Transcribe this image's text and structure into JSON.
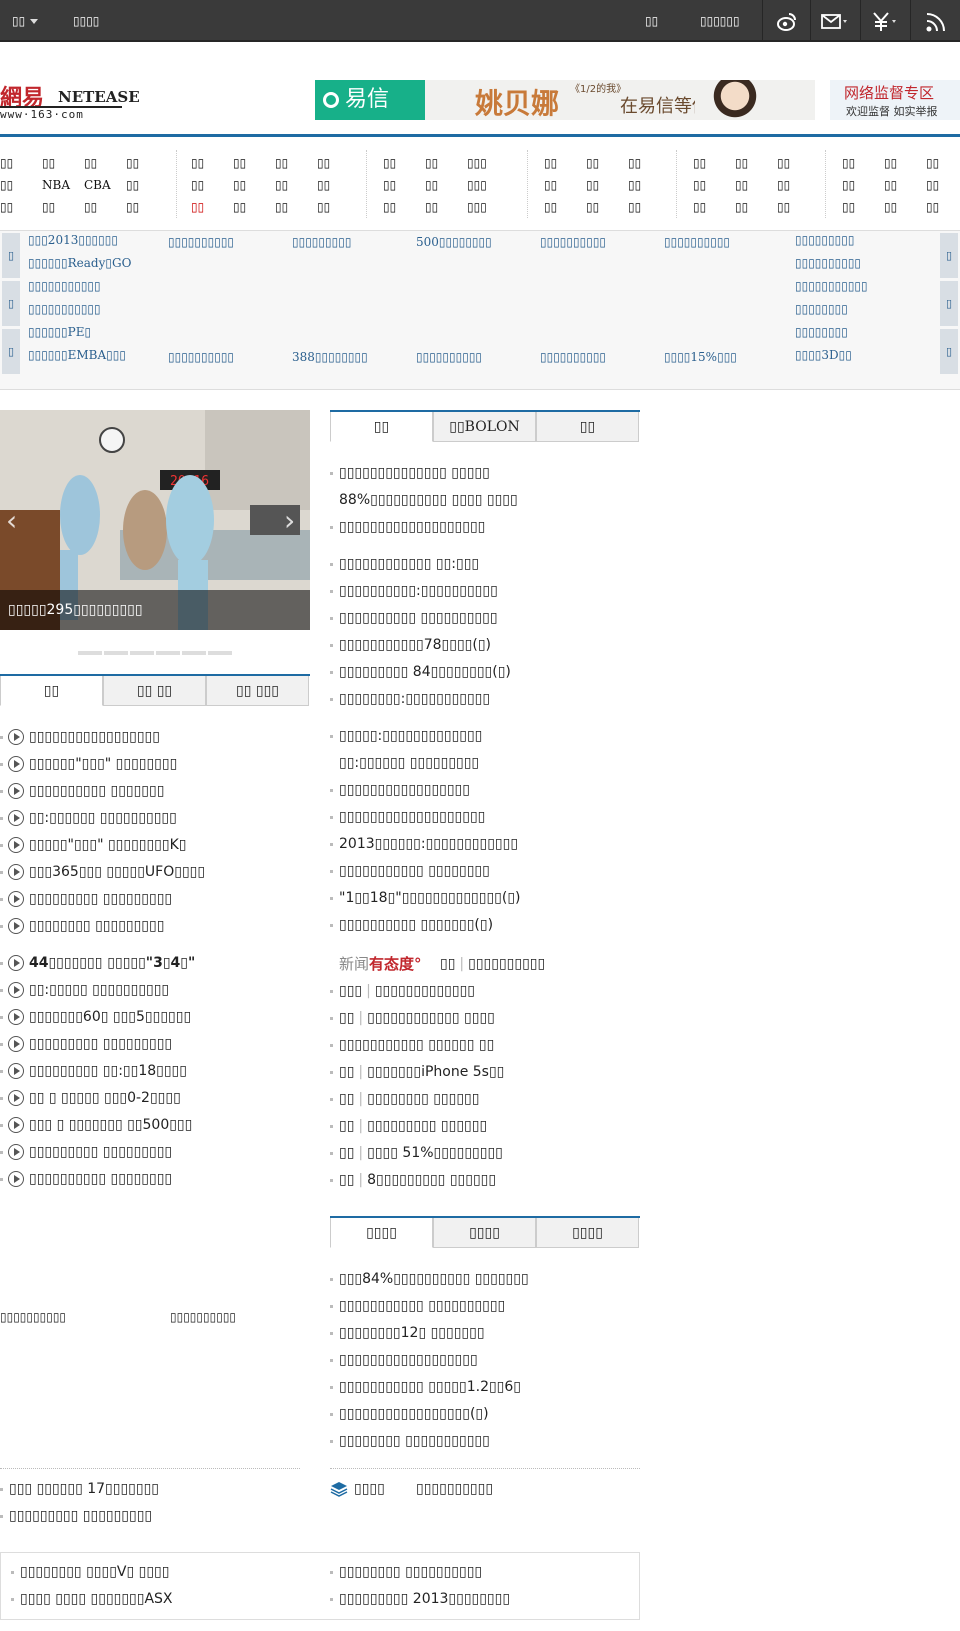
{
  "topbar": {
    "left_menu": "▯▯",
    "left_link": "▯▯▯▯",
    "right_link1": "▯▯",
    "right_link2": "▯▯▯▯▯▯",
    "icons": [
      "weibo-icon",
      "mail-icon",
      "money-icon",
      "rss-icon"
    ]
  },
  "header": {
    "logo_cn": "網易",
    "logo_en": "NETEASE",
    "logo_url": "www·163·com",
    "ad_brand": "易信",
    "ad_name": "姚贝娜",
    "ad_sub": "《1/2的我》",
    "ad_slogan": "在易信等你",
    "report_title": "网络监督专区",
    "report_sub": "欢迎监督 如实举报"
  },
  "nav": {
    "groups": [
      [
        [
          "▯▯",
          "▯▯",
          "▯▯",
          "▯▯"
        ],
        [
          "▯▯",
          "NBA",
          "CBA",
          "▯▯"
        ],
        [
          "▯▯",
          "▯▯",
          "▯▯",
          "▯▯"
        ]
      ],
      [
        [
          "▯▯",
          "▯▯",
          "▯▯",
          "▯▯"
        ],
        [
          "▯▯",
          "▯▯",
          "▯▯",
          "▯▯"
        ],
        [
          "▯▯",
          "▯▯",
          "▯▯",
          "▯▯"
        ]
      ],
      [
        [
          "▯▯",
          "▯▯",
          "▯▯▯"
        ],
        [
          "▯▯",
          "▯▯",
          "▯▯▯"
        ],
        [
          "▯▯",
          "▯▯",
          "▯▯▯"
        ]
      ],
      [
        [
          "▯▯",
          "▯▯",
          "▯▯"
        ],
        [
          "▯▯",
          "▯▯",
          "▯▯"
        ],
        [
          "▯▯",
          "▯▯",
          "▯▯"
        ]
      ],
      [
        [
          "▯▯",
          "▯▯",
          "▯▯"
        ],
        [
          "▯▯",
          "▯▯",
          "▯▯"
        ],
        [
          "▯▯",
          "▯▯",
          "▯▯"
        ]
      ],
      [
        [
          "▯▯",
          "▯▯",
          "▯▯"
        ],
        [
          "▯▯",
          "▯▯",
          "▯▯"
        ],
        [
          "▯▯",
          "▯▯",
          "▯▯"
        ]
      ]
    ],
    "active_label": "▯▯"
  },
  "promo": {
    "tab_labels": [
      "▯",
      "▯",
      "▯",
      "▯",
      "▯",
      "▯"
    ],
    "col1": [
      "▯▯▯2013▯▯▯▯▯▯",
      "▯▯▯▯▯▯Ready▯GO",
      "▯▯▯▯▯▯▯▯▯▯▯",
      "▯▯▯▯▯▯▯▯▯▯▯",
      "▯▯▯▯▯▯PE▯",
      "▯▯▯▯▯▯EMBA▯▯▯"
    ],
    "row1": [
      "▯▯▯▯▯▯▯▯▯▯",
      "▯▯▯▯▯▯▯▯▯",
      "500▯▯▯▯▯▯▯▯",
      "▯▯▯▯▯▯▯▯▯▯",
      "▯▯▯▯▯▯▯▯▯▯"
    ],
    "row2": [
      "▯▯▯▯▯▯▯▯▯▯",
      "388▯▯▯▯▯▯▯▯",
      "▯▯▯▯▯▯▯▯▯▯",
      "▯▯▯▯▯▯▯▯▯▯",
      "▯▯▯▯15%▯▯▯"
    ],
    "col7": [
      "▯▯▯▯▯▯▯▯▯",
      "▯▯▯▯▯▯▯▯▯▯",
      "▯▯▯▯▯▯▯▯▯▯▯",
      "▯▯▯▯▯▯▯▯",
      "▯▯▯▯▯▯▯▯",
      "▯▯▯▯3D▯▯"
    ]
  },
  "slider": {
    "caption": "▯▯▯▯▯295▯▯▯▯▯▯▯▯▯",
    "slide_count": 6
  },
  "left_tabs": [
    "▯▯",
    "▯▯ ▯▯",
    "▯▯ ▯▯▯"
  ],
  "mid_tabs": [
    "▯▯",
    "▯▯BOLON",
    "▯▯"
  ],
  "finance_tabs": [
    "▯▯▯▯",
    "▯▯▯▯",
    "▯▯▯▯"
  ],
  "video_list": [
    "▯▯▯▯▯▯▯▯▯▯▯▯▯▯▯▯▯",
    "▯▯▯▯▯▯\"▯▯▯\" ▯▯▯▯▯▯▯▯",
    "▯▯▯▯▯▯▯▯▯▯ ▯▯▯▯▯▯▯",
    "▯▯:▯▯▯▯▯▯ ▯▯▯▯▯▯▯▯▯▯",
    "▯▯▯▯▯\"▯▯▯\" ▯▯▯▯▯▯▯▯K▯",
    "▯▯▯365▯▯▯ ▯▯▯▯▯UFO▯▯▯▯",
    "▯▯▯▯▯▯▯▯▯ ▯▯▯▯▯▯▯▯▯",
    "▯▯▯▯▯▯▯▯ ▯▯▯▯▯▯▯▯▯",
    "44▯▯▯▯▯▯▯ ▯▯▯▯▯\"3▯4▯\"",
    "▯▯:▯▯▯▯▯ ▯▯▯▯▯▯▯▯▯▯",
    "▯▯▯▯▯▯▯60▯ ▯▯▯5▯▯▯▯▯▯",
    "▯▯▯▯▯▯▯▯▯ ▯▯▯▯▯▯▯▯▯",
    "▯▯▯▯▯▯▯▯▯ ▯▯:▯▯18▯▯▯▯",
    "▯▯ ▯ ▯▯▯▯▯ ▯▯▯0-2▯▯▯▯",
    "▯▯▯ ▯ ▯▯▯▯▯▯▯ ▯▯500▯▯▯",
    "▯▯▯▯▯▯▯▯▯ ▯▯▯▯▯▯▯▯▯",
    "▯▯▯▯▯▯▯▯▯▯ ▯▯▯▯▯▯▯▯"
  ],
  "headline_list": [
    "▯▯▯▯▯▯▯▯▯▯▯▯▯▯ ▯▯▯▯▯",
    "88%▯▯▯▯▯▯▯▯▯▯  ▯▯▯▯ ▯▯▯▯",
    "▯▯▯▯▯▯▯▯▯▯▯▯▯▯▯▯▯▯▯",
    "▯▯▯▯▯▯▯▯▯▯▯▯ ▯▯:▯▯▯",
    "▯▯▯▯▯▯▯▯▯▯:▯▯▯▯▯▯▯▯▯▯",
    "▯▯▯▯▯▯▯▯▯▯ ▯▯▯▯▯▯▯▯▯▯",
    "▯▯▯▯▯▯▯▯▯▯▯78▯▯▯▯(▯)",
    "▯▯▯▯▯▯▯▯▯ 84▯▯▯▯▯▯▯▯(▯)",
    "▯▯▯▯▯▯▯▯:▯▯▯▯▯▯▯▯▯▯▯",
    "▯▯▯▯▯:▯▯▯▯▯▯▯▯▯▯▯▯▯",
    "▯▯:▯▯▯▯▯▯ ▯▯▯▯▯▯▯▯▯",
    "▯▯▯▯▯▯▯▯▯▯▯▯▯▯▯▯▯",
    "▯▯▯▯▯▯▯▯▯▯▯▯▯▯▯▯▯▯▯",
    "2013▯▯▯▯▯▯:▯▯▯▯▯▯▯▯▯▯▯▯",
    "▯▯▯▯▯▯▯▯▯▯▯ ▯▯▯▯▯▯▯▯",
    "\"1▯▯18▯\"▯▯▯▯▯▯▯▯▯▯▯▯▯(▯)",
    "▯▯▯▯▯▯▯▯▯▯ ▯▯▯▯▯▯▯(▯)"
  ],
  "attitude": {
    "logo_text": "新闻有态度°",
    "head_tag": "▯▯",
    "head_text": "▯▯▯▯▯▯▯▯▯▯"
  },
  "attitude_list": [
    [
      "▯▯▯",
      "▯▯▯▯▯▯▯▯▯▯▯▯▯"
    ],
    [
      "▯▯",
      "▯▯▯▯▯▯▯▯▯▯▯▯ ▯▯▯▯"
    ],
    [
      "",
      "▯▯▯▯▯▯▯▯▯▯▯ ▯▯▯▯▯▯ ▯▯"
    ],
    [
      "▯▯",
      "▯▯▯▯▯▯▯iPhone 5s▯▯"
    ],
    [
      "▯▯",
      "▯▯▯▯▯▯▯▯ ▯▯▯▯▯▯"
    ],
    [
      "▯▯",
      "▯▯▯▯▯▯▯▯▯ ▯▯▯▯▯▯"
    ],
    [
      "▯▯",
      "▯▯▯▯ 51%▯▯▯▯▯▯▯▯▯"
    ],
    [
      "▯▯",
      "8▯▯▯▯▯▯▯▯▯ ▯▯▯▯▯▯"
    ]
  ],
  "finance_list": [
    "▯▯▯84%▯▯▯▯▯▯▯▯▯▯ ▯▯▯▯▯▯▯",
    "▯▯▯▯▯▯▯▯▯▯▯ ▯▯▯▯▯▯▯▯▯▯",
    "▯▯▯▯▯▯▯▯12▯ ▯▯▯▯▯▯▯",
    "▯▯▯▯▯▯▯▯▯▯▯▯▯▯▯▯▯▯",
    "▯▯▯▯▯▯▯▯▯▯▯ ▯▯▯▯▯1.2▯▯6▯",
    "▯▯▯▯▯▯▯▯▯▯▯▯▯▯▯▯▯(▯)",
    "▯▯▯▯▯▯▯▯ ▯▯▯▯▯▯▯▯▯▯▯"
  ],
  "left_labels": [
    "▯▯▯▯▯▯▯▯▯▯",
    "▯▯▯▯▯▯▯▯▯▯"
  ],
  "left_bottom_list": [
    "▯▯▯ ▯▯▯▯▯▯ 17▯▯▯▯▯▯▯",
    "▯▯▯▯▯▯▯▯▯ ▯▯▯▯▯▯▯▯▯"
  ],
  "mid_bottom": {
    "label": "▯▯▯▯",
    "text": "▯▯▯▯▯▯▯▯▯▯"
  },
  "box_list": [
    [
      "▯▯▯▯▯▯▯▯ ▯▯▯▯V▯ ▯▯▯▯",
      "▯▯▯▯▯▯▯▯ ▯▯▯▯▯▯▯▯▯▯"
    ],
    [
      "▯▯▯▯ ▯▯▯▯ ▯▯▯▯▯▯▯ASX",
      "▯▯▯▯▯▯▯▯▯ 2013▯▯▯▯▯▯▯▯"
    ]
  ],
  "colors": {
    "topbar": "#3a3a3a",
    "accent_blue": "#1e6ba3",
    "link_blue": "#2a5f8e",
    "red": "#c1272d",
    "yixin_green": "#17b089"
  }
}
